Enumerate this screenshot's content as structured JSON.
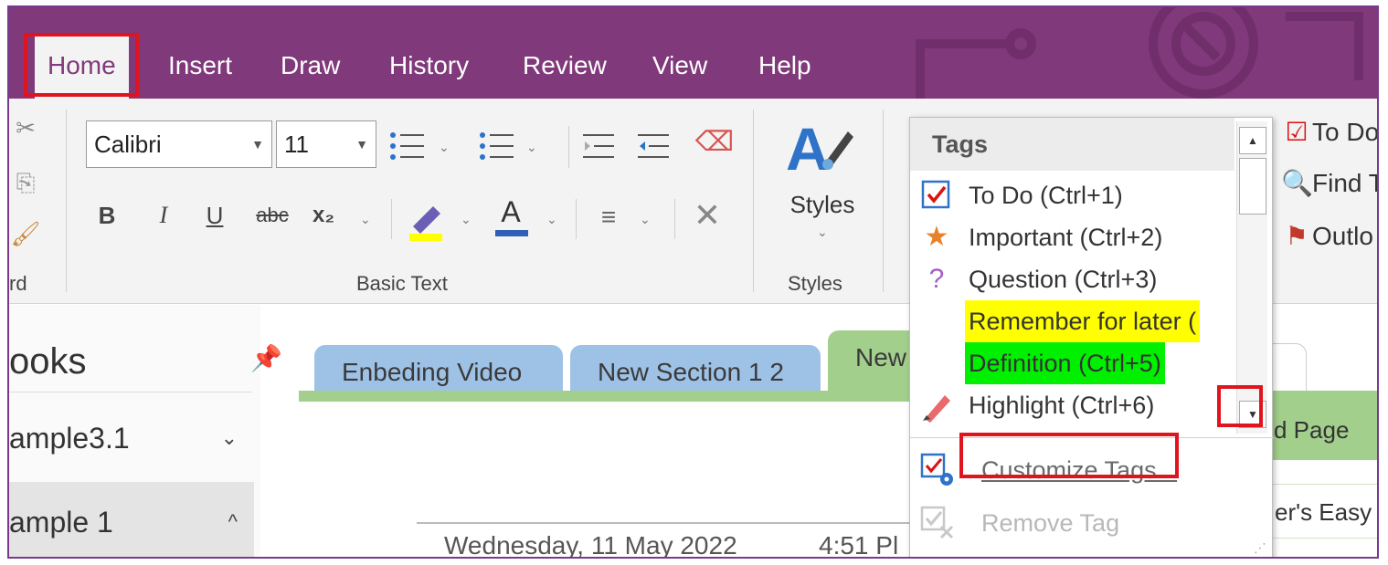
{
  "tabs": [
    "Home",
    "Insert",
    "Draw",
    "History",
    "Review",
    "View",
    "Help"
  ],
  "ribbon": {
    "clipboard_label": "rd",
    "font_name": "Calibri",
    "font_size": "11",
    "basic_text_label": "Basic Text",
    "styles_button": "Styles",
    "styles_label": "Styles",
    "bold": "B",
    "italic": "I",
    "underline": "U",
    "strike": "abc",
    "subscript": "x₂",
    "font_color_letter": "A"
  },
  "tags_panel": {
    "header": "Tags",
    "items": [
      {
        "label": "To Do (Ctrl+1)",
        "icon": "checkbox-icon"
      },
      {
        "label": "Important (Ctrl+2)",
        "icon": "star-icon"
      },
      {
        "label": "Question (Ctrl+3)",
        "icon": "question-icon"
      },
      {
        "label": "Remember for later (",
        "icon": "none",
        "highlight": "#ffff00"
      },
      {
        "label": "Definition (Ctrl+5)",
        "icon": "none",
        "highlight": "#00f000"
      },
      {
        "label": "Highlight (Ctrl+6)",
        "icon": "highlighter-pen-icon"
      }
    ],
    "customize": "Customize Tags...",
    "remove": "Remove Tag"
  },
  "right_ribbon": {
    "todo": "To Do",
    "find": "Find T",
    "outlook": "Outlo"
  },
  "notebooks": {
    "title": "ooks",
    "items": [
      {
        "label": "ample3.1",
        "chevron": "⌄"
      },
      {
        "label": "ample 1",
        "chevron": "^"
      }
    ]
  },
  "sections": [
    "Enbeding Video",
    "New Section 1 2",
    "New"
  ],
  "page": {
    "add_page": "d Page",
    "page_title": "er's Easy G",
    "date": "Wednesday, 11 May 2022",
    "time": "4:51 Pl"
  },
  "colors": {
    "tabbar": "#80397b",
    "highlight_box": "#e0141e",
    "section_blue": "#9ec1e6",
    "section_green": "#a3cf8c"
  }
}
